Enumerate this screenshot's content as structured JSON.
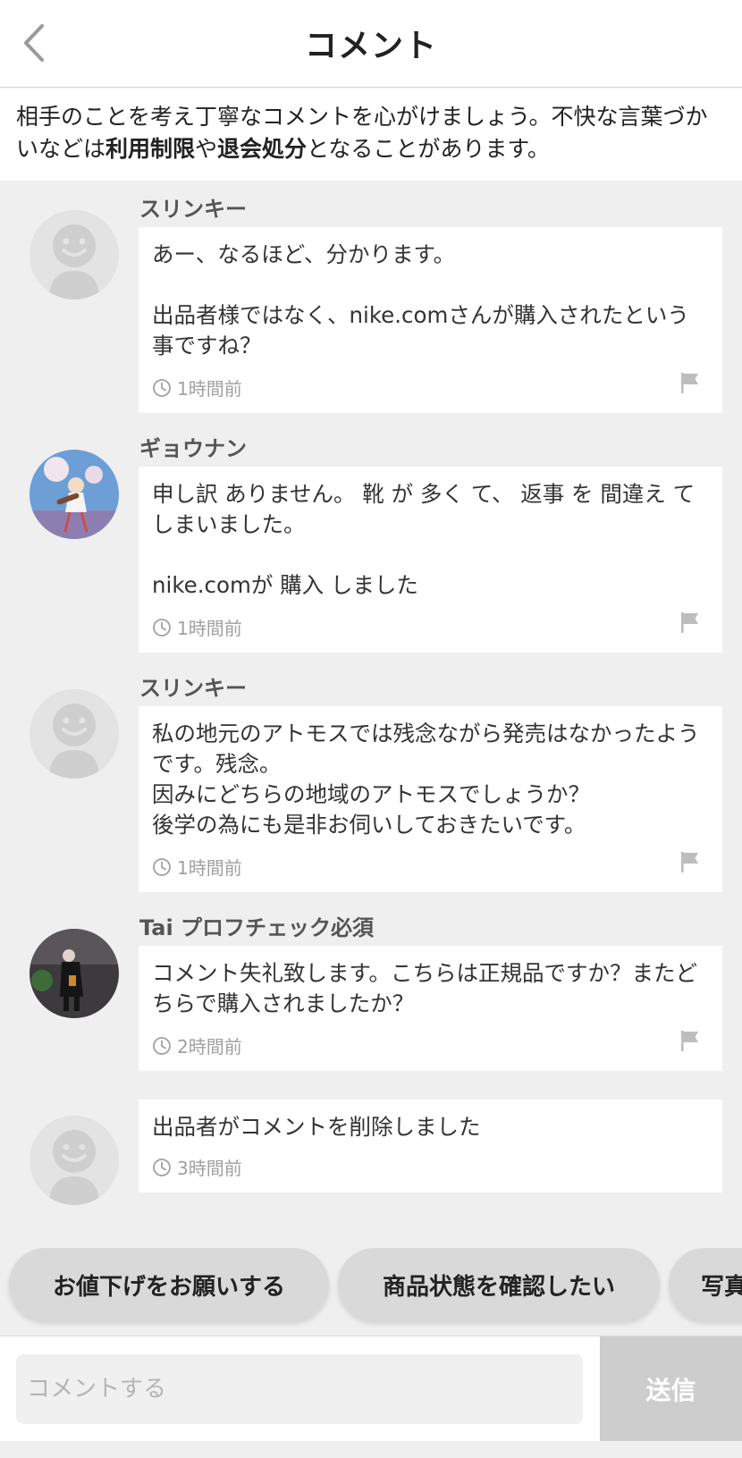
{
  "header": {
    "title": "コメント",
    "back_icon": "chevron-left-icon"
  },
  "notice": {
    "part1": "相手のことを考え丁寧なコメントを心がけましょう。不快な言葉づかいなどは",
    "bold1": "利用制限",
    "part2": "や",
    "bold2": "退会処分",
    "part3": "となることがあります。"
  },
  "comments": [
    {
      "username": "スリンキー",
      "avatar": "default-avatar-icon",
      "body": "あー、なるほど、分かります。\n\n出品者様ではなく、nike.comさんが購入されたという事ですね？",
      "time": "1時間前"
    },
    {
      "username": "ギョウナン",
      "avatar": "illustration-avatar",
      "body": "申し訳 ありません。 靴 が 多く て、 返事 を 間違え てしまいました。\n\nnike.comが 購入 しました",
      "time": "1時間前"
    },
    {
      "username": "スリンキー",
      "avatar": "default-avatar-icon",
      "body": "私の地元のアトモスでは残念ながら発売はなかったようです。残念。\n因みにどちらの地域のアトモスでしょうか？\n後学の為にも是非お伺いしておきたいです。",
      "time": "1時間前"
    },
    {
      "username": "Tai プロフチェック必須",
      "avatar": "photo-avatar",
      "body": "コメント失礼致します。こちらは正規品ですか？またどちらで購入されましたか？",
      "time": "2時間前"
    },
    {
      "username": "",
      "avatar": "default-avatar-icon",
      "body": "出品者がコメントを削除しました",
      "time": "3時間前"
    }
  ],
  "quick_replies": [
    "お値下げをお願いする",
    "商品状態を確認したい",
    "写真"
  ],
  "composer": {
    "placeholder": "コメントする",
    "send_label": "送信"
  },
  "colors": {
    "background": "#efefef",
    "card": "#ffffff",
    "chip": "#d9d9d9",
    "send_disabled": "#cdcdcd"
  }
}
